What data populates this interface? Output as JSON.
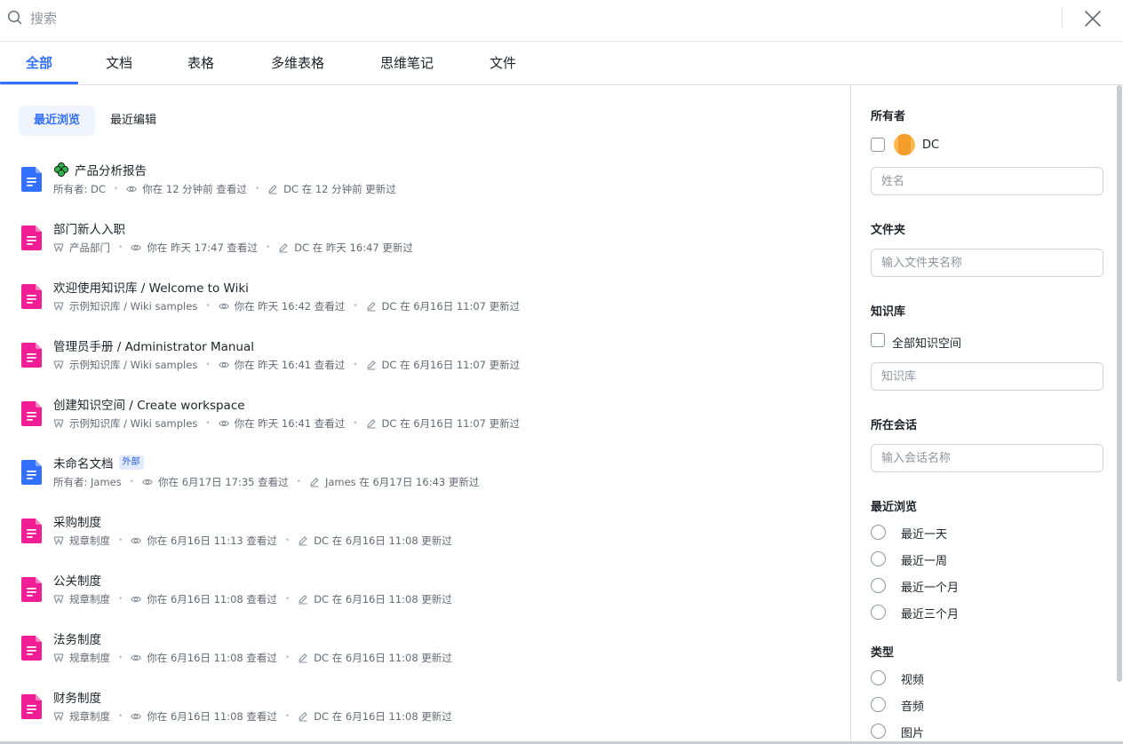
{
  "search": {
    "placeholder": "搜索"
  },
  "tabs": [
    {
      "label": "全部"
    },
    {
      "label": "文档"
    },
    {
      "label": "表格"
    },
    {
      "label": "多维表格"
    },
    {
      "label": "思维笔记"
    },
    {
      "label": "文件"
    }
  ],
  "subtabs": [
    {
      "label": "最近浏览"
    },
    {
      "label": "最近编辑"
    }
  ],
  "documents": [
    {
      "icon": "doc-blue-icon",
      "color": "#3370ff",
      "title": "产品分析报告",
      "title_icon": "clover-icon",
      "badge": "",
      "location_label": "所有者: DC",
      "location_icon": "",
      "viewed": "你在 12 分钟前 查看过",
      "updated": "DC 在 12 分钟前 更新过"
    },
    {
      "icon": "doc-pink-icon",
      "color": "#f01d94",
      "title": "部门新人入职",
      "badge": "",
      "location_label": "产品部门",
      "location_icon": "wiki-icon",
      "viewed": "你在 昨天 17:47 查看过",
      "updated": "DC 在 昨天 16:47 更新过"
    },
    {
      "icon": "doc-pink-icon",
      "color": "#f01d94",
      "title": "欢迎使用知识库 / Welcome to Wiki",
      "badge": "",
      "location_label": "示例知识库 / Wiki samples",
      "location_icon": "wiki-icon",
      "viewed": "你在 昨天 16:42 查看过",
      "updated": "DC 在 6月16日 11:07 更新过"
    },
    {
      "icon": "doc-pink-icon",
      "color": "#f01d94",
      "title": "管理员手册 / Administrator Manual",
      "badge": "",
      "location_label": "示例知识库 / Wiki samples",
      "location_icon": "wiki-icon",
      "viewed": "你在 昨天 16:41 查看过",
      "updated": "DC 在 6月16日 11:07 更新过"
    },
    {
      "icon": "doc-pink-icon",
      "color": "#f01d94",
      "title": "创建知识空间 / Create workspace",
      "badge": "",
      "location_label": "示例知识库 / Wiki samples",
      "location_icon": "wiki-icon",
      "viewed": "你在 昨天 16:41 查看过",
      "updated": "DC 在 6月16日 11:07 更新过"
    },
    {
      "icon": "doc-blue-icon",
      "color": "#3370ff",
      "title": "未命名文档",
      "badge": "外部",
      "location_label": "所有者: James",
      "location_icon": "",
      "viewed": "你在 6月17日 17:35 查看过",
      "updated": "James 在 6月17日 16:43 更新过"
    },
    {
      "icon": "doc-pink-icon",
      "color": "#f01d94",
      "title": "采购制度",
      "badge": "",
      "location_label": "规章制度",
      "location_icon": "wiki-icon",
      "viewed": "你在 6月16日 11:13 查看过",
      "updated": "DC 在 6月16日 11:08 更新过"
    },
    {
      "icon": "doc-pink-icon",
      "color": "#f01d94",
      "title": "公关制度",
      "badge": "",
      "location_label": "规章制度",
      "location_icon": "wiki-icon",
      "viewed": "你在 6月16日 11:08 查看过",
      "updated": "DC 在 6月16日 11:08 更新过"
    },
    {
      "icon": "doc-pink-icon",
      "color": "#f01d94",
      "title": "法务制度",
      "badge": "",
      "location_label": "规章制度",
      "location_icon": "wiki-icon",
      "viewed": "你在 6月16日 11:08 查看过",
      "updated": "DC 在 6月16日 11:08 更新过"
    },
    {
      "icon": "doc-pink-icon",
      "color": "#f01d94",
      "title": "财务制度",
      "badge": "",
      "location_label": "规章制度",
      "location_icon": "wiki-icon",
      "viewed": "你在 6月16日 11:08 查看过",
      "updated": "DC 在 6月16日 11:08 更新过"
    }
  ],
  "filters": {
    "owner": {
      "title": "所有者",
      "option": "DC",
      "name_placeholder": "姓名"
    },
    "folder": {
      "title": "文件夹",
      "placeholder": "输入文件夹名称"
    },
    "wiki": {
      "title": "知识库",
      "option": "全部知识空间",
      "placeholder": "知识库"
    },
    "chat": {
      "title": "所在会话",
      "placeholder": "输入会话名称"
    },
    "recent": {
      "title": "最近浏览",
      "options": [
        "最近一天",
        "最近一周",
        "最近一个月",
        "最近三个月"
      ]
    },
    "type": {
      "title": "类型",
      "options": [
        "视频",
        "音频",
        "图片"
      ]
    }
  },
  "colors": {
    "accent": "#3370ff",
    "doc_blue": "#3370ff",
    "doc_pink": "#f01d94",
    "text_secondary": "#646a73"
  }
}
